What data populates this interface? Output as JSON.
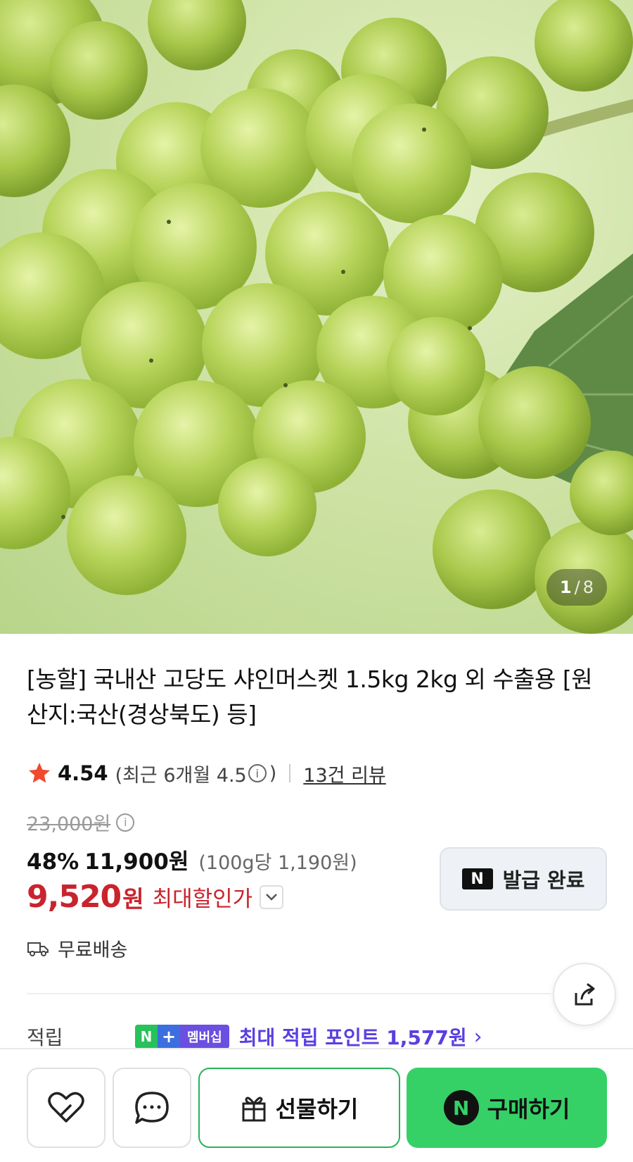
{
  "gallery": {
    "current": "1",
    "separator": "/",
    "total": "8"
  },
  "product": {
    "title": "[농할] 국내산 고당도 샤인머스켓 1.5kg 2kg 외 수출용 [원산지:국산(경상북도) 등]"
  },
  "rating": {
    "score": "4.54",
    "recent_prefix": "(최근 6개월 4.5",
    "recent_suffix": ")",
    "info_glyph": "i",
    "review_link": "13건 리뷰"
  },
  "price": {
    "original": "23,000원",
    "discount_pct": "48%",
    "sale_price": "11,900원",
    "unit_price": "(100g당 1,190원)",
    "best_price": "9,520",
    "best_won": "원",
    "best_label": "최대할인가"
  },
  "coupon": {
    "badge": "N",
    "label": "발급 완료"
  },
  "shipping": {
    "label": "무료배송"
  },
  "points": {
    "label": "적립",
    "badge_n": "N",
    "badge_plus": "+",
    "badge_membership": "멤버십",
    "text": "최대 적립 포인트 1,577원",
    "chevron": "›"
  },
  "bottom_bar": {
    "gift_label": "선물하기",
    "buy_badge": "N",
    "buy_label": "구매하기"
  },
  "colors": {
    "accent_red": "#c9232d",
    "naver_green": "#35d167",
    "points_purple": "#5a3fe0"
  },
  "icons": [
    "star-icon",
    "info-icon",
    "chevron-down-icon",
    "truck-icon",
    "share-icon",
    "heart-icon",
    "chat-icon",
    "gift-icon"
  ]
}
